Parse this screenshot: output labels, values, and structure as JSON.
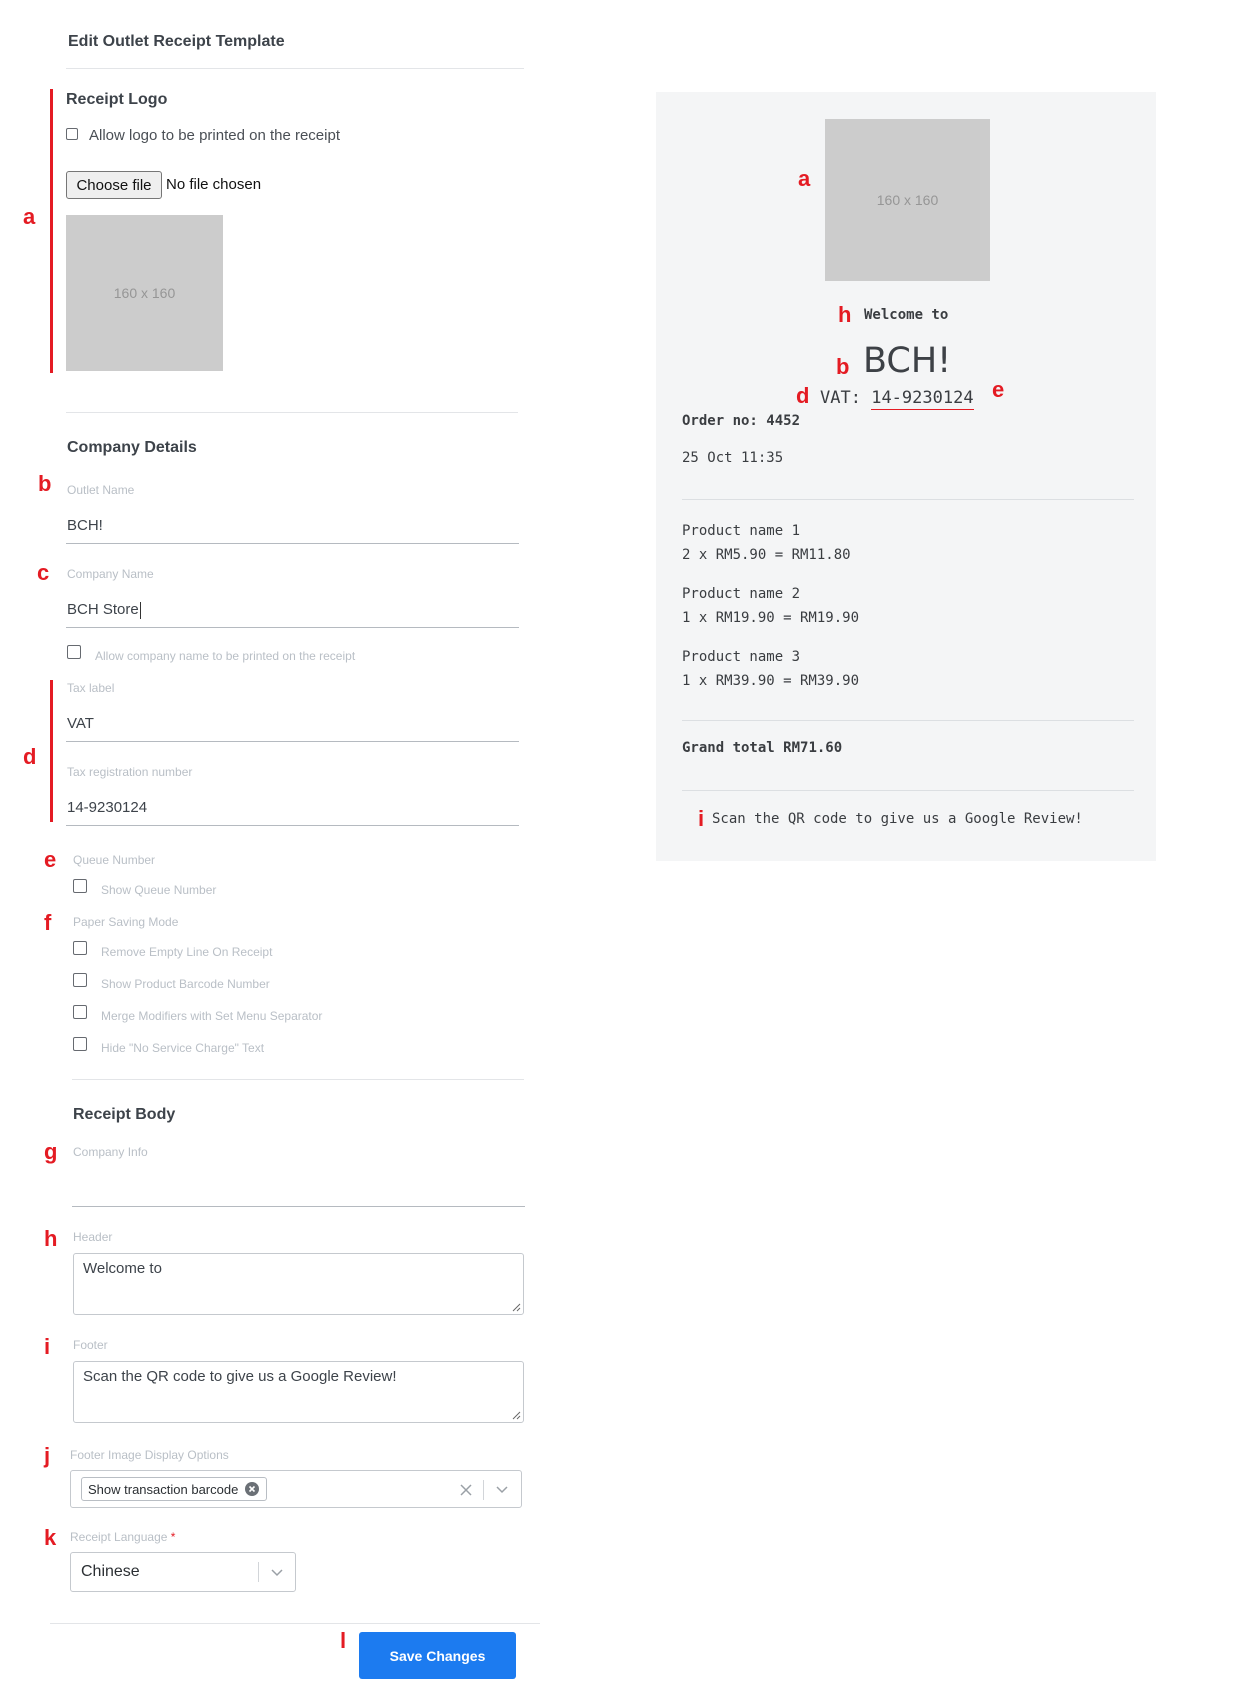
{
  "page": {
    "title": "Edit Outlet Receipt Template"
  },
  "markers": {
    "a": "a",
    "b": "b",
    "c": "c",
    "d": "d",
    "e": "e",
    "f": "f",
    "g": "g",
    "h": "h",
    "i": "i",
    "j": "j",
    "k": "k",
    "l": "l"
  },
  "logo_section": {
    "title": "Receipt Logo",
    "allow_logo_label": "Allow logo to be printed on the receipt",
    "allow_logo_checked": false,
    "choose_file_label": "Choose file",
    "no_file_text": "No file chosen",
    "placeholder_text": "160 x 160"
  },
  "company_section": {
    "title": "Company Details",
    "outlet_name_label": "Outlet Name",
    "outlet_name_value": "BCH!",
    "company_name_label": "Company Name",
    "company_name_value": "BCH Store",
    "allow_company_label": "Allow company name to be printed on the receipt",
    "tax_label_label": "Tax label",
    "tax_label_value": "VAT",
    "tax_reg_label": "Tax registration number",
    "tax_reg_value": "14-9230124",
    "queue_label": "Queue Number",
    "show_queue_label": "Show Queue Number",
    "paper_saving_label": "Paper Saving Mode",
    "paper_saving_options": [
      "Remove Empty Line On Receipt",
      "Show Product Barcode Number",
      "Merge Modifiers with Set Menu Separator",
      "Hide \"No Service Charge\" Text"
    ]
  },
  "body_section": {
    "title": "Receipt Body",
    "company_info_label": "Company Info",
    "company_info_value": "",
    "header_label": "Header",
    "header_value": "Welcome to",
    "footer_label": "Footer",
    "footer_value": "Scan the QR code to give us a Google Review!",
    "footer_image_label": "Footer Image Display Options",
    "footer_image_chip": "Show transaction barcode",
    "language_label": "Receipt Language",
    "language_required_mark": "*",
    "language_value": "Chinese"
  },
  "actions": {
    "save_label": "Save Changes"
  },
  "receipt_preview": {
    "logo_text": "160 x 160",
    "header": "Welcome to",
    "outlet_name": "BCH!",
    "tax_label": "VAT:",
    "tax_number": "14-9230124",
    "order_no_label": "Order no:",
    "order_no": "4452",
    "datetime": "25 Oct 11:35",
    "items": [
      {
        "name": "Product name 1",
        "line": "2 x RM5.90 = RM11.80"
      },
      {
        "name": "Product name 2",
        "line": "1 x RM19.90 = RM19.90"
      },
      {
        "name": "Product name 3",
        "line": "1 x RM39.90 = RM39.90"
      }
    ],
    "grand_total_label": "Grand total",
    "grand_total_value": "RM71.60",
    "footer": "Scan the QR code to give us a Google Review!"
  },
  "colors": {
    "accent": "#1c7bf0",
    "marker": "#e41b23",
    "receipt_bg": "#f4f5f6"
  }
}
